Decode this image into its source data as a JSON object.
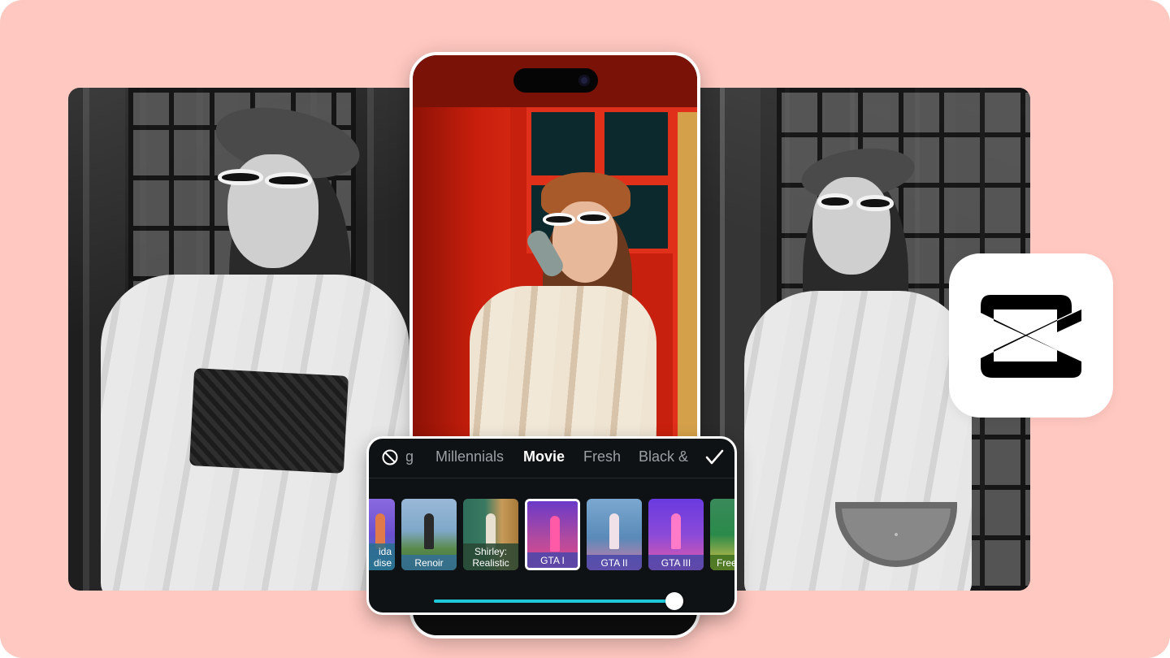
{
  "filter_panel": {
    "tabs": [
      {
        "label": "ıg"
      },
      {
        "label": "Millennials"
      },
      {
        "label": "Movie"
      },
      {
        "label": "Fresh"
      },
      {
        "label": "Black &"
      }
    ],
    "active_tab": "Movie",
    "filters": [
      {
        "label": "ida\ndise",
        "bg": "#6a4fd0",
        "accent": "#4aa8c8"
      },
      {
        "label": "Renoir",
        "bg": "#7fa8c8",
        "accent": "#3c6a3c"
      },
      {
        "label": "Shirley:\nRealistic",
        "bg": "#2e6e5a",
        "accent": "#c89a5a"
      },
      {
        "label": "GTA I",
        "bg": "#b04aa0",
        "accent": "#e84a88"
      },
      {
        "label": "GTA II",
        "bg": "#5a8ab8",
        "accent": "#d87aa8"
      },
      {
        "label": "GTA III",
        "bg": "#8a4ad8",
        "accent": "#e85aa8"
      },
      {
        "label": "Free",
        "bg": "#2a8a4a",
        "accent": "#e8c84a"
      }
    ],
    "selected_filter": "GTA I",
    "intensity": 1.0,
    "slider_color": "#1ec8d8"
  },
  "colors": {
    "background": "#ffc8c0",
    "panel": "#0f1214",
    "brand_icon": "#000000"
  },
  "icons": {
    "none": "prohibited-icon",
    "confirm": "checkmark-icon",
    "brand": "capcut-logo-icon"
  }
}
